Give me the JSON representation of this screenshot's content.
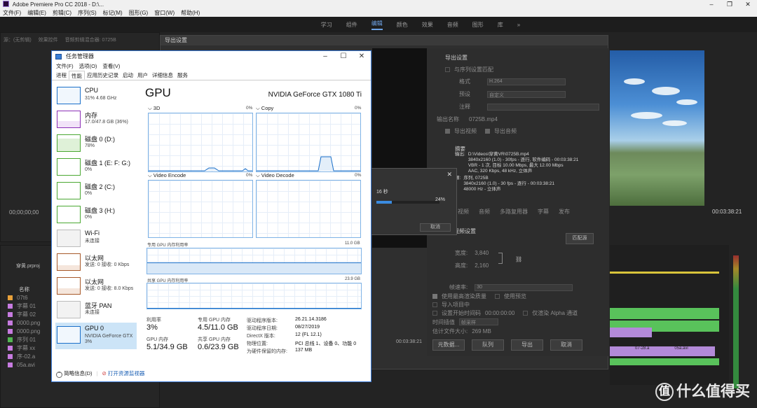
{
  "premiere": {
    "title": "Adobe Premiere Pro CC 2018 - D:\\...",
    "menu": [
      "文件(F)",
      "编辑(E)",
      "剪辑(C)",
      "序列(S)",
      "标记(M)",
      "图形(G)",
      "窗口(W)",
      "帮助(H)"
    ],
    "workspaces": [
      "学习",
      "组件",
      "编辑",
      "颜色",
      "效果",
      "音频",
      "图形",
      "库"
    ],
    "active_workspace": "编辑",
    "left_tabs": [
      "源：(无剪辑)",
      "效果控件",
      "音频剪辑混合器: 0725B"
    ],
    "src_timecode": "00;00;00;00",
    "project_name": "穿黄.prproj",
    "col_name": "名称",
    "files": [
      "07t6",
      "字幕 01",
      "字幕 02",
      "0000.png",
      "0000.png",
      "序列 01",
      "字幕 xx",
      "序-02.a",
      "05a.avi"
    ],
    "right_timecode": "00:03:38:21",
    "seq_timecode": "00:03:38:21",
    "clip_labels": [
      "07-28.a",
      "05a.avi"
    ]
  },
  "export_dialog": {
    "title": "导出设置",
    "section": "导出设置",
    "match_seq": "与序列设置匹配",
    "format_label": "格式",
    "format_value": "H.264",
    "preset_label": "预设",
    "preset_value": "自定义",
    "comment_label": "注释",
    "output_label": "输出名称",
    "output_value": "0725B.mp4",
    "export_video": "导出视频",
    "export_audio": "导出音频",
    "summary_title": "摘要",
    "summary_out_label": "输出:",
    "summary_out": [
      "D:\\Videos\\穿黄VR\\0725B.mp4",
      "3840x2160 (1.0) - 30fps - 逐行, 软件编码 - 00:03:38:21",
      "VBR - 1 次, 目标 10.00 Mbps, 最大 12.00 Mbps",
      "AAC, 320 Kbps, 48 kHz, 立体声"
    ],
    "summary_src_label": "源:",
    "summary_src": [
      "序列, 0725B",
      "3840x2160 (1.0) - 30 fps - 逐行 - 00:03:38:21",
      "48000 Hz - 立体声"
    ],
    "tabs": [
      "效果",
      "视频",
      "音频",
      "多路复用器",
      "字幕",
      "发布"
    ],
    "vs_title": "基本视频设置",
    "match_source_btn": "匹配源",
    "width_label": "宽度:",
    "width_value": "3,840",
    "height_label": "高度:",
    "height_value": "2,160",
    "fps_label": "帧速率:",
    "fps_value": "30",
    "max_render": "使用最高渲染质量",
    "use_preview": "使用预览",
    "import_proj": "导入项目中",
    "set_start": "设置开始时间码",
    "start_tc": "00:00:00:00",
    "render_alpha": "仅渲染 Alpha 通道",
    "time_interp_label": "时间插值",
    "time_interp_value": "帧采样",
    "est_size_label": "估计文件大小:",
    "est_size_value": "269 MB",
    "btn_metadata": "元数据...",
    "btn_queue": "队列",
    "btn_export": "导出",
    "btn_cancel": "取消",
    "timeline_tc": "00:03:38:21"
  },
  "encoding_progress": {
    "remain": "16 秒",
    "pct_value": 0.24,
    "pct_text": "24%",
    "cancel": "取消"
  },
  "task_manager": {
    "title": "任务管理器",
    "menu": [
      "文件(F)",
      "选项(O)",
      "查看(V)"
    ],
    "tabs": [
      "进程",
      "性能",
      "应用历史记录",
      "启动",
      "用户",
      "详细信息",
      "服务"
    ],
    "active_tab": "性能",
    "side": [
      {
        "title": "CPU",
        "sub": "31% 4.68 GHz",
        "color": "#1a6fc9"
      },
      {
        "title": "内存",
        "sub": "17.0/47.8 GB (36%)",
        "color": "#8b2fb6"
      },
      {
        "title": "磁盘 0 (D:)",
        "sub": "78%",
        "color": "#4aa832"
      },
      {
        "title": "磁盘 1 (E: F: G:)",
        "sub": "0%",
        "color": "#4aa832"
      },
      {
        "title": "磁盘 2 (C:)",
        "sub": "0%",
        "color": "#4aa832"
      },
      {
        "title": "磁盘 3 (H:)",
        "sub": "0%",
        "color": "#4aa832"
      },
      {
        "title": "Wi-Fi",
        "sub": "未连接",
        "color": "#999999"
      },
      {
        "title": "以太网",
        "sub": "发送: 0 接收: 0 Kbps",
        "color": "#a7592a"
      },
      {
        "title": "以太网",
        "sub": "发送: 0 接收: 8.0 Kbps",
        "color": "#a7592a"
      },
      {
        "title": "蓝牙 PAN",
        "sub": "未连接",
        "color": "#999999"
      },
      {
        "title": "GPU 0",
        "sub": "NVIDIA GeForce GTX\n3%",
        "color": "#1a6fc9"
      }
    ],
    "gpu_heading": "GPU",
    "gpu_name": "NVIDIA GeForce GTX 1080 Ti",
    "engines": [
      {
        "name": "3D",
        "pct": "0%"
      },
      {
        "name": "Copy",
        "pct": "0%"
      },
      {
        "name": "Video Encode",
        "pct": "0%"
      },
      {
        "name": "Video Decode",
        "pct": "0%"
      }
    ],
    "dedicated_label": "专用 GPU 内存利用率",
    "dedicated_max": "11.0 GB",
    "shared_label": "共享 GPU 内存利用率",
    "shared_max": "23.9 GB",
    "stats": {
      "util_label": "利用率",
      "util_value": "3%",
      "gpu_mem_label": "GPU 内存",
      "gpu_mem_value": "5.1/34.9 GB",
      "ded_label": "专用 GPU 内存",
      "ded_value": "4.5/11.0 GB",
      "shr_label": "共享 GPU 内存",
      "shr_value": "0.6/23.9 GB"
    },
    "info": [
      [
        "驱动程序版本:",
        "26.21.14.3186"
      ],
      [
        "驱动程序日期:",
        "08/27/2019"
      ],
      [
        "DirectX 版本:",
        "12 (FL 12.1)"
      ],
      [
        "物理位置:",
        "PCI 总线 1、设备 0、功能 0"
      ],
      [
        "为硬件保留的内存:",
        "137 MB"
      ]
    ],
    "footer_brief": "简略信息(D)",
    "footer_monitor": "打开资源监视器"
  },
  "watermark": "什么值得买"
}
